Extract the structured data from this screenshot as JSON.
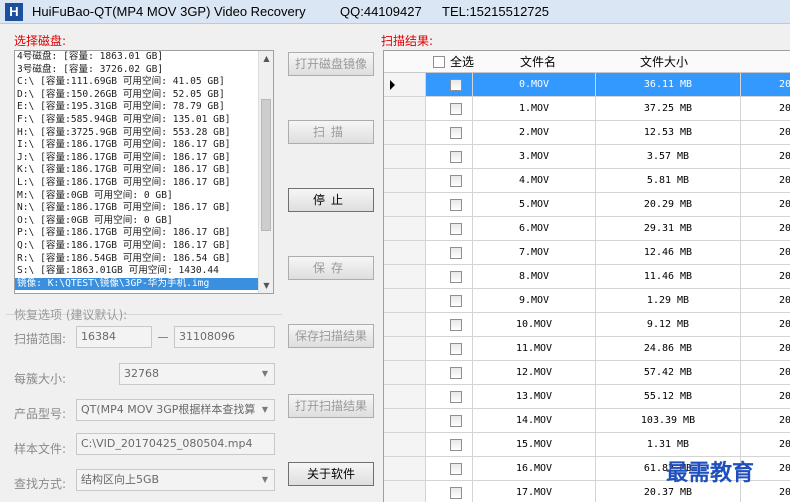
{
  "title": {
    "app": "HuiFuBao-QT(MP4 MOV 3GP) Video Recovery",
    "qq": "QQ:44109427",
    "tel": "TEL:15215512725",
    "logo": "H"
  },
  "disk_panel": {
    "label": "选择磁盘:",
    "items": [
      "4号磁盘: [容量: 1863.01 GB]",
      "3号磁盘: [容量: 3726.02 GB]",
      "C:\\ [容量:111.69GB 可用空间: 41.05 GB]",
      "D:\\ [容量:150.26GB 可用空间: 52.05 GB]",
      "E:\\ [容量:195.31GB 可用空间: 78.79 GB]",
      "F:\\ [容量:585.94GB 可用空间: 135.01 GB]",
      "H:\\ [容量:3725.9GB 可用空间: 553.28 GB]",
      "I:\\ [容量:186.17GB 可用空间: 186.17 GB]",
      "J:\\ [容量:186.17GB 可用空间: 186.17 GB]",
      "K:\\ [容量:186.17GB 可用空间: 186.17 GB]",
      "L:\\ [容量:186.17GB 可用空间: 186.17 GB]",
      "M:\\ [容量:0GB 可用空间: 0 GB]",
      "N:\\ [容量:186.17GB 可用空间: 186.17 GB]",
      "O:\\ [容量:0GB 可用空间: 0 GB]",
      "P:\\ [容量:186.17GB 可用空间: 186.17 GB]",
      "Q:\\ [容量:186.17GB 可用空间: 186.17 GB]",
      "R:\\ [容量:186.54GB 可用空间: 186.54 GB]",
      "S:\\ [容量:1863.01GB 可用空间: 1430.44",
      "镜像: K:\\QTEST\\镜像\\3GP-华为手机.img"
    ],
    "selected_index": 18
  },
  "buttons": {
    "open_image": "打开磁盘镜像",
    "scan": "扫描",
    "stop": "停止",
    "save": "保存",
    "save_result": "保存扫描结果",
    "open_result": "打开扫描结果",
    "about": "关于软件"
  },
  "options": {
    "group_title": "恢复选项 (建议默认):",
    "scan_range_label": "扫描范围:",
    "scan_range_start": "16384",
    "scan_range_end": "31108096",
    "cluster_label": "每簇大小:",
    "cluster_value": "32768",
    "product_label": "产品型号:",
    "product_value": "QT(MP4 MOV 3GP根据样本查找算",
    "sample_label": "样本文件:",
    "sample_value": "C:\\VID_20170425_080504.mp4",
    "search_label": "查找方式:",
    "search_value": "结构区向上5GB"
  },
  "results": {
    "label": "扫描结果:",
    "select_all": "全选",
    "col_name": "文件名",
    "col_size": "文件大小",
    "col_extra_fragment": "20",
    "rows": [
      {
        "name": "0.MOV",
        "size": "36.11 MB",
        "selected": true
      },
      {
        "name": "1.MOV",
        "size": "37.25 MB"
      },
      {
        "name": "2.MOV",
        "size": "12.53 MB"
      },
      {
        "name": "3.MOV",
        "size": "3.57 MB"
      },
      {
        "name": "4.MOV",
        "size": "5.81 MB"
      },
      {
        "name": "5.MOV",
        "size": "20.29 MB"
      },
      {
        "name": "6.MOV",
        "size": "29.31 MB"
      },
      {
        "name": "7.MOV",
        "size": "12.46 MB"
      },
      {
        "name": "8.MOV",
        "size": "11.46 MB"
      },
      {
        "name": "9.MOV",
        "size": "1.29 MB"
      },
      {
        "name": "10.MOV",
        "size": "9.12 MB"
      },
      {
        "name": "11.MOV",
        "size": "24.86 MB"
      },
      {
        "name": "12.MOV",
        "size": "57.42 MB"
      },
      {
        "name": "13.MOV",
        "size": "55.12 MB"
      },
      {
        "name": "14.MOV",
        "size": "103.39 MB"
      },
      {
        "name": "15.MOV",
        "size": "1.31 MB"
      },
      {
        "name": "16.MOV",
        "size": "61.82 MB"
      },
      {
        "name": "17.MOV",
        "size": "20.37 MB"
      }
    ]
  },
  "watermark": "最需教育"
}
